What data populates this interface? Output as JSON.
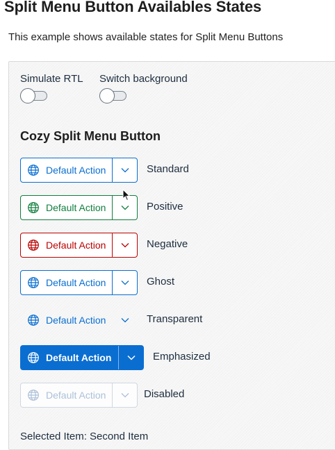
{
  "page": {
    "title": "Split Menu Button Availables States",
    "subtitle": "This example shows available states for Split Menu Buttons"
  },
  "controls": {
    "rtl": {
      "label": "Simulate RTL",
      "checked": false
    },
    "background": {
      "label": "Switch background",
      "checked": false
    }
  },
  "section_title": "Cozy Split Menu Button",
  "buttons": [
    {
      "action_label": "Default Action",
      "state": "Standard",
      "color": "#0a6ed1",
      "border": "#0a6ed1",
      "icon": "globe-icon"
    },
    {
      "action_label": "Default Action",
      "state": "Positive",
      "color": "#107e3e",
      "border": "#107e3e",
      "icon": "globe-icon"
    },
    {
      "action_label": "Default Action",
      "state": "Negative",
      "color": "#bb0000",
      "border": "#bb0000",
      "icon": "globe-icon"
    },
    {
      "action_label": "Default Action",
      "state": "Ghost",
      "color": "#0a6ed1",
      "border": "#0a6ed1",
      "icon": "globe-icon"
    },
    {
      "action_label": "Default Action",
      "state": "Transparent",
      "color": "#0a6ed1",
      "border": "transparent",
      "icon": "globe-icon"
    },
    {
      "action_label": "Default Action",
      "state": "Emphasized",
      "color": "#ffffff",
      "border": "#0a6ed1",
      "background": "#0a6ed1",
      "icon": "globe-icon"
    },
    {
      "action_label": "Default Action",
      "state": "Disabled",
      "color": "#9fb8d4",
      "border": "#c9d3de",
      "icon": "globe-icon"
    }
  ],
  "selected": "Selected Item: Second Item"
}
